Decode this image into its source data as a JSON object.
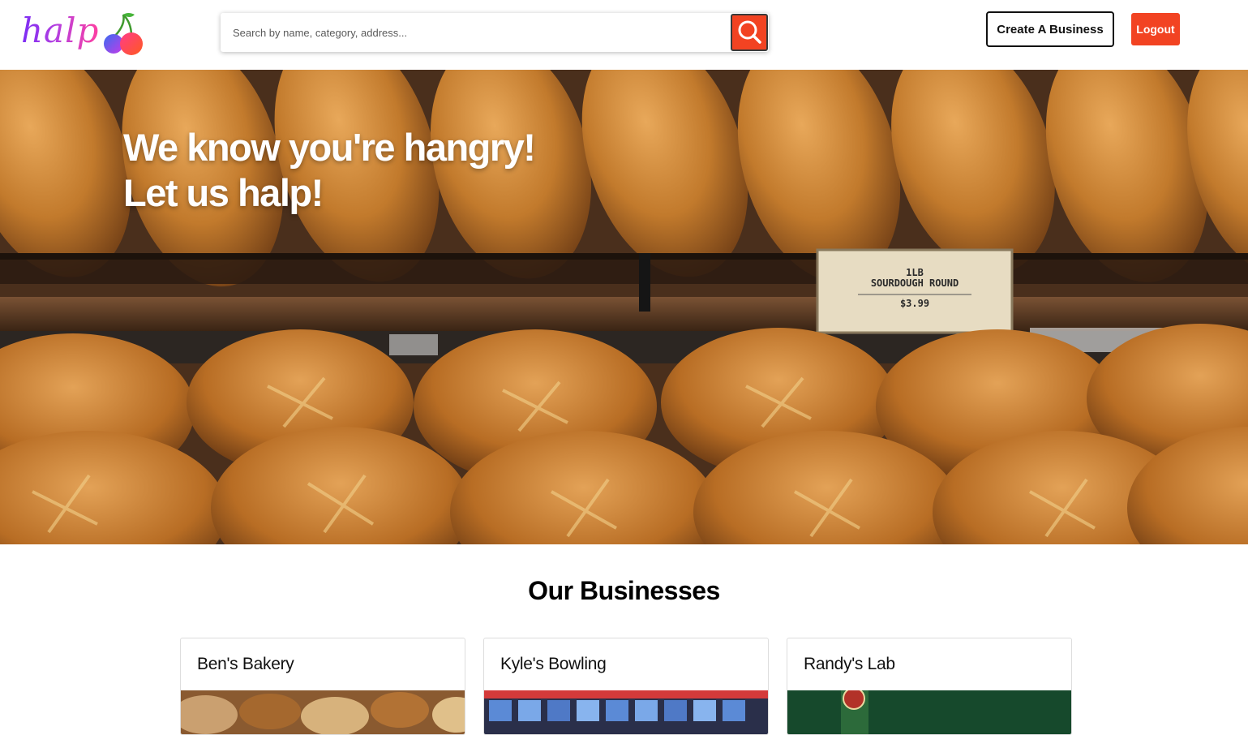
{
  "header": {
    "logo_text": "halp",
    "search": {
      "placeholder": "Search by name, category, address...",
      "value": ""
    },
    "create_business_label": "Create A Business",
    "logout_label": "Logout"
  },
  "hero": {
    "line1": "We know you're hangry!",
    "line2": "Let us halp!",
    "price_sign": {
      "line1": "1LB",
      "line2": "SOURDOUGH ROUND",
      "line3": "$3.99"
    }
  },
  "businesses": {
    "title": "Our Businesses",
    "items": [
      {
        "name": "Ben's Bakery"
      },
      {
        "name": "Kyle's Bowling"
      },
      {
        "name": "Randy's Lab"
      }
    ]
  },
  "colors": {
    "accent": "#f24322",
    "logo_gradient": [
      "#7a2cf5",
      "#ff3fa0"
    ]
  },
  "icons": {
    "search": "search-icon",
    "logo": "cherries-icon"
  }
}
